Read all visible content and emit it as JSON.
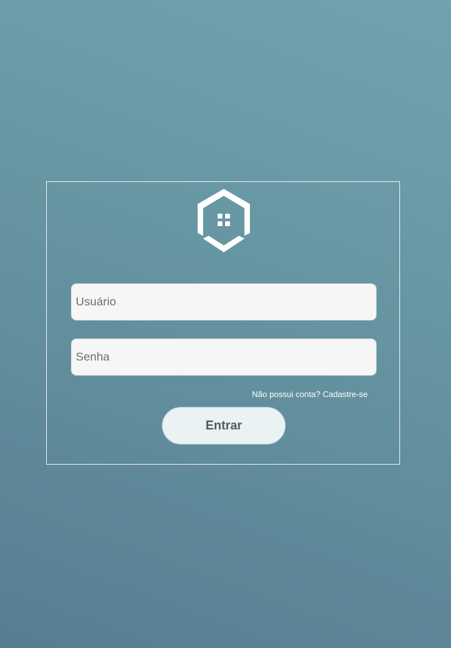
{
  "logo": {
    "icon": "house-icon",
    "color": "#ffffff"
  },
  "form": {
    "username": {
      "value": "",
      "placeholder": "Usuário"
    },
    "password": {
      "value": "",
      "placeholder": "Senha"
    },
    "signup_prompt": "Não possui conta?",
    "signup_link": "Cadastre-se",
    "submit_label": "Entrar"
  },
  "colors": {
    "background_top": "#70a3ae",
    "background_bottom": "#587d91",
    "card_border": "#e8f0f2",
    "input_bg": "#f7f6f7",
    "button_bg": "#eaf2f3",
    "button_text": "#555b5e"
  }
}
